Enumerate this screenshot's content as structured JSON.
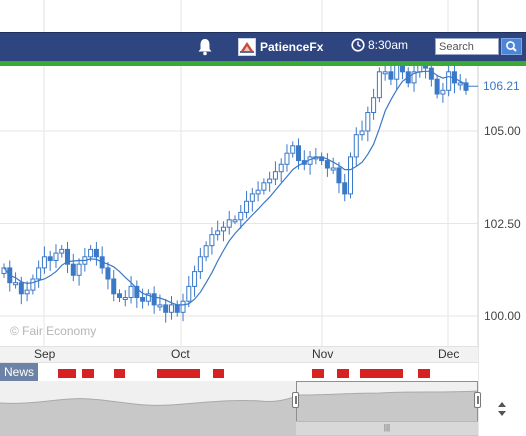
{
  "header": {
    "brand": "PatienceFx",
    "time": "8:30am",
    "search_placeholder": "Search",
    "bell_icon": "bell-icon",
    "clock_icon": "clock-icon",
    "search_icon": "search-icon",
    "bar_color": "#2f4580",
    "accent_green": "#3aaa35"
  },
  "chart": {
    "current_price": "106.21",
    "y_ticks": [
      "105.00",
      "102.50",
      "100.00"
    ],
    "x_months": [
      "Sep",
      "Oct",
      "Nov",
      "Dec"
    ],
    "copyright": "© Fair Economy",
    "news_label": "News"
  },
  "chart_data": {
    "type": "candlestick",
    "series_color": "#3a78c8",
    "ylim_visible": [
      99.7,
      106.8
    ],
    "y_ticks": [
      100.0,
      102.5,
      105.0
    ],
    "last_price": 106.21,
    "closes": [
      101.3,
      100.9,
      100.9,
      100.6,
      100.7,
      101.0,
      101.3,
      101.6,
      101.5,
      101.7,
      101.8,
      101.4,
      101.1,
      101.4,
      101.6,
      101.8,
      101.6,
      101.3,
      101.0,
      100.6,
      100.5,
      100.5,
      100.8,
      100.5,
      100.4,
      100.6,
      100.3,
      100.3,
      100.1,
      100.3,
      100.1,
      100.4,
      100.8,
      101.2,
      101.6,
      101.9,
      102.2,
      102.3,
      102.4,
      102.6,
      102.6,
      102.8,
      103.1,
      103.3,
      103.4,
      103.6,
      103.7,
      103.9,
      104.1,
      104.4,
      104.6,
      104.2,
      104.1,
      104.3,
      104.3,
      104.2,
      104.0,
      104.0,
      103.6,
      103.3,
      104.3,
      104.9,
      105.0,
      105.5,
      105.9,
      106.6,
      106.6,
      106.4,
      106.8,
      106.6,
      106.3,
      106.6,
      106.9,
      106.7,
      106.4,
      106.0,
      106.1,
      106.6,
      106.3,
      106.3,
      106.1
    ],
    "news_event_markers": 9
  }
}
